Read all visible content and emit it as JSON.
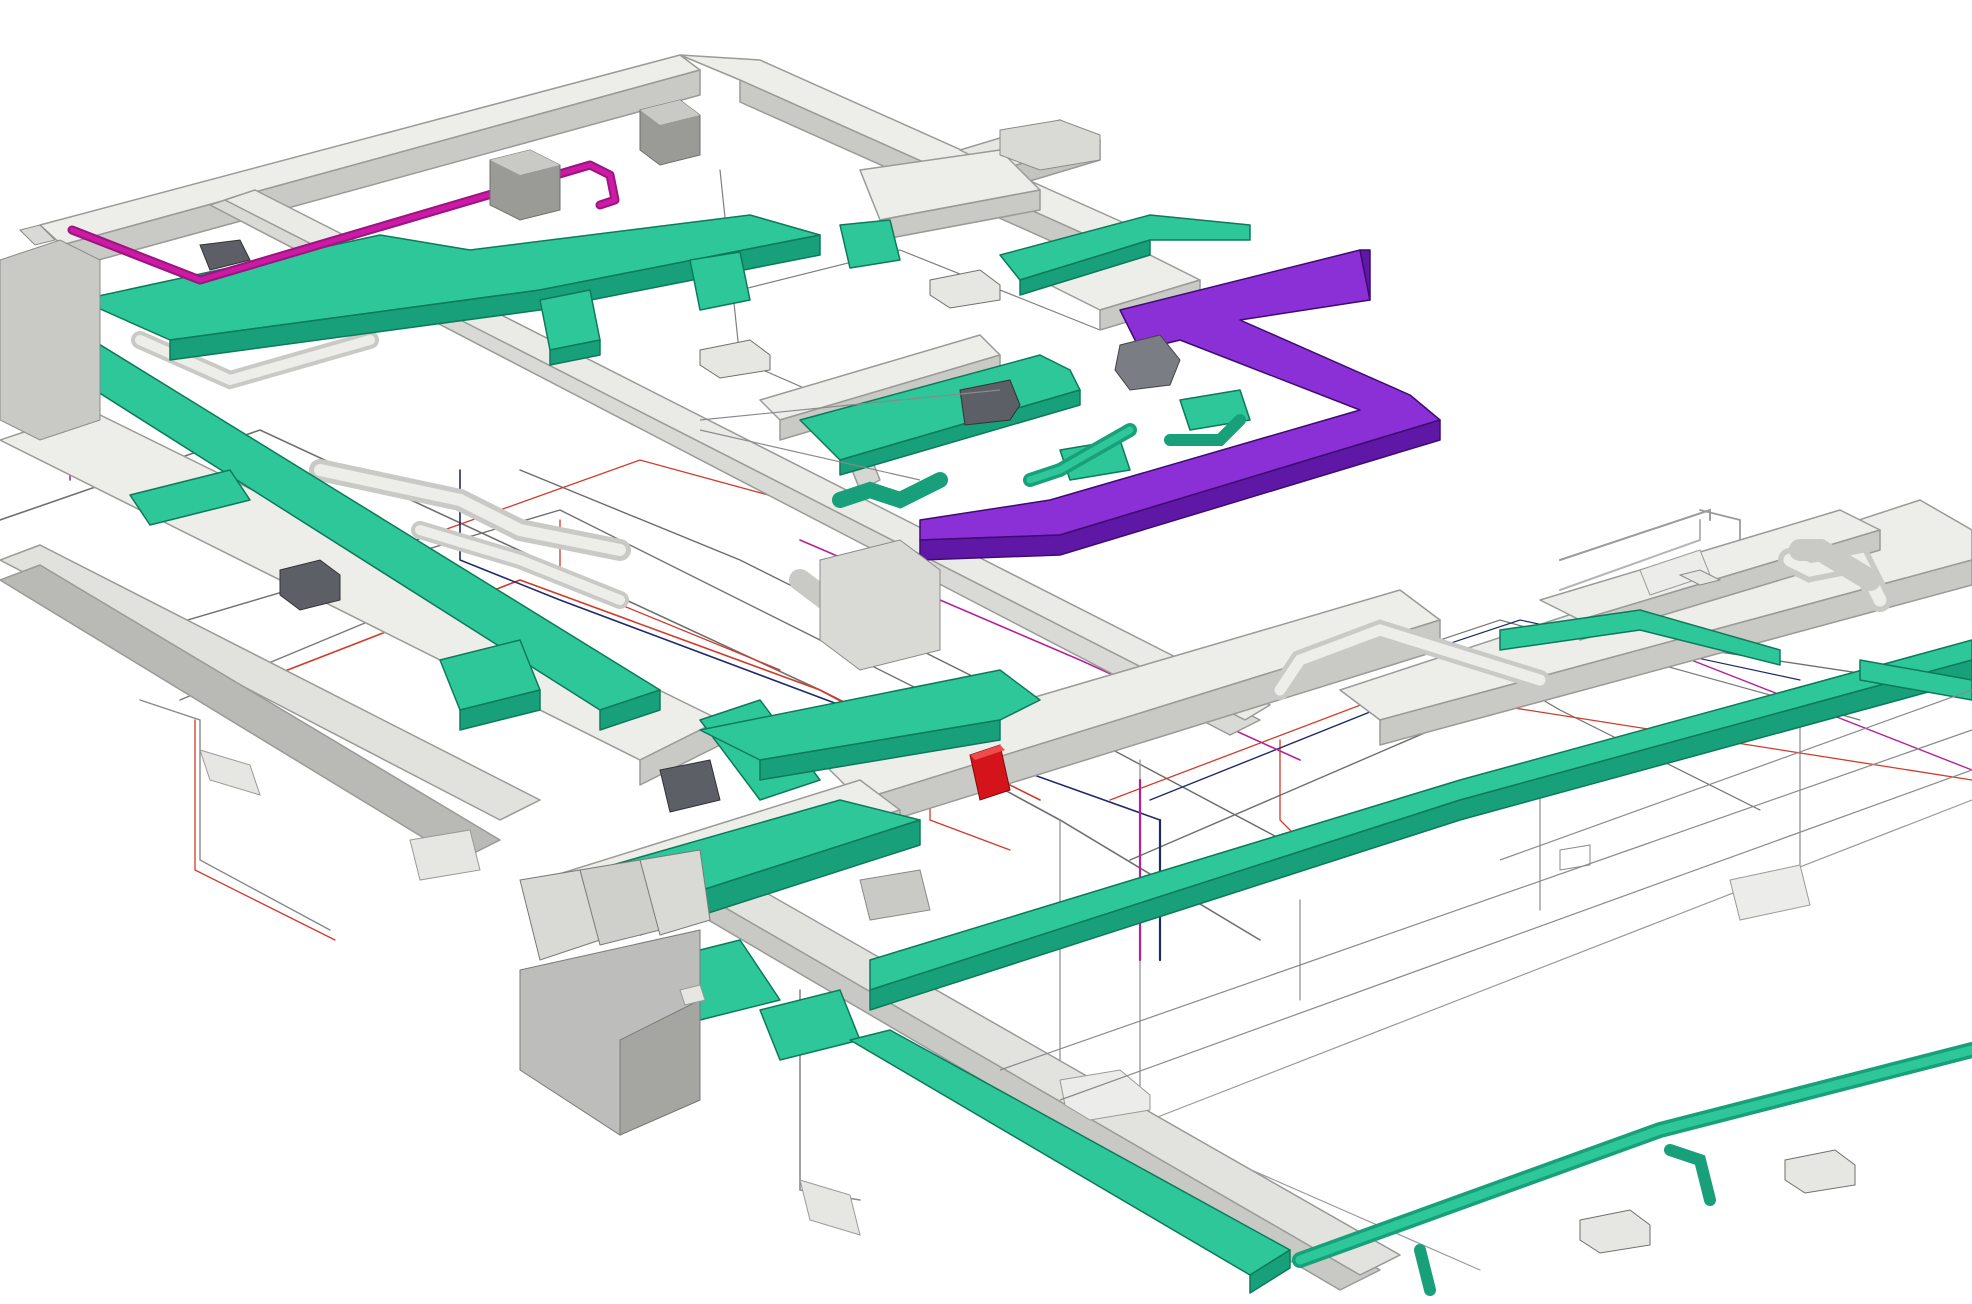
{
  "scene": {
    "background_color": "#ffffff"
  },
  "colors": {
    "grey_duct_top": "#ededea",
    "grey_duct_side": "#c9c9c6",
    "grey_duct_edge": "#9a9a97",
    "green_duct_top": "#2ec79a",
    "green_duct_side": "#17a079",
    "green_duct_edge": "#0d7a5a",
    "purple_duct_top": "#8b2fd6",
    "purple_duct_side": "#5f18a5",
    "purple_duct_edge": "#3e0c70",
    "magenta_pipe": "#cc1aa5",
    "red_pipe": "#d23a2a",
    "navy_pipe": "#1f2a6b",
    "thin_line": "#707070",
    "red_unit": "#d4141a",
    "equipment_face": "#bdbdbb",
    "equipment_dark": "#5c5f66"
  },
  "icons": [
    "air-handling-unit-icon",
    "fan-coil-unit-icon",
    "ceiling-diffuser-icon",
    "wall-grille-icon",
    "red-control-panel-icon"
  ]
}
